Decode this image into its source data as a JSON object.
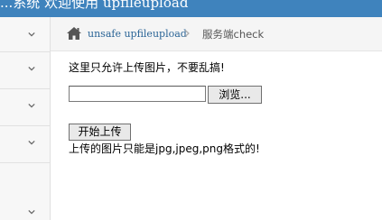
{
  "header": {
    "title": "...系统 欢迎使用 upfileupload"
  },
  "sidebar": {
    "items": [
      {
        "label": ""
      },
      {
        "label": ""
      },
      {
        "label": ""
      },
      {
        "label": ""
      },
      {
        "label": ""
      }
    ]
  },
  "breadcrumb": {
    "link": "unsafe upfileupload",
    "current": "服务端check"
  },
  "main": {
    "notice": "这里只允许上传图片，不要乱搞!",
    "file_input_value": "",
    "browse_label": "浏览...",
    "upload_label": "开始上传",
    "hint": "上传的图片只能是jpg,jpeg,png格式的!"
  },
  "colors": {
    "topbar": "#3f83bd",
    "link": "#2a6496",
    "sidebar_bg": "#f7f7f7"
  },
  "icons": [
    "home-icon",
    "chevron-right-icon",
    "chevron-down-icon"
  ]
}
